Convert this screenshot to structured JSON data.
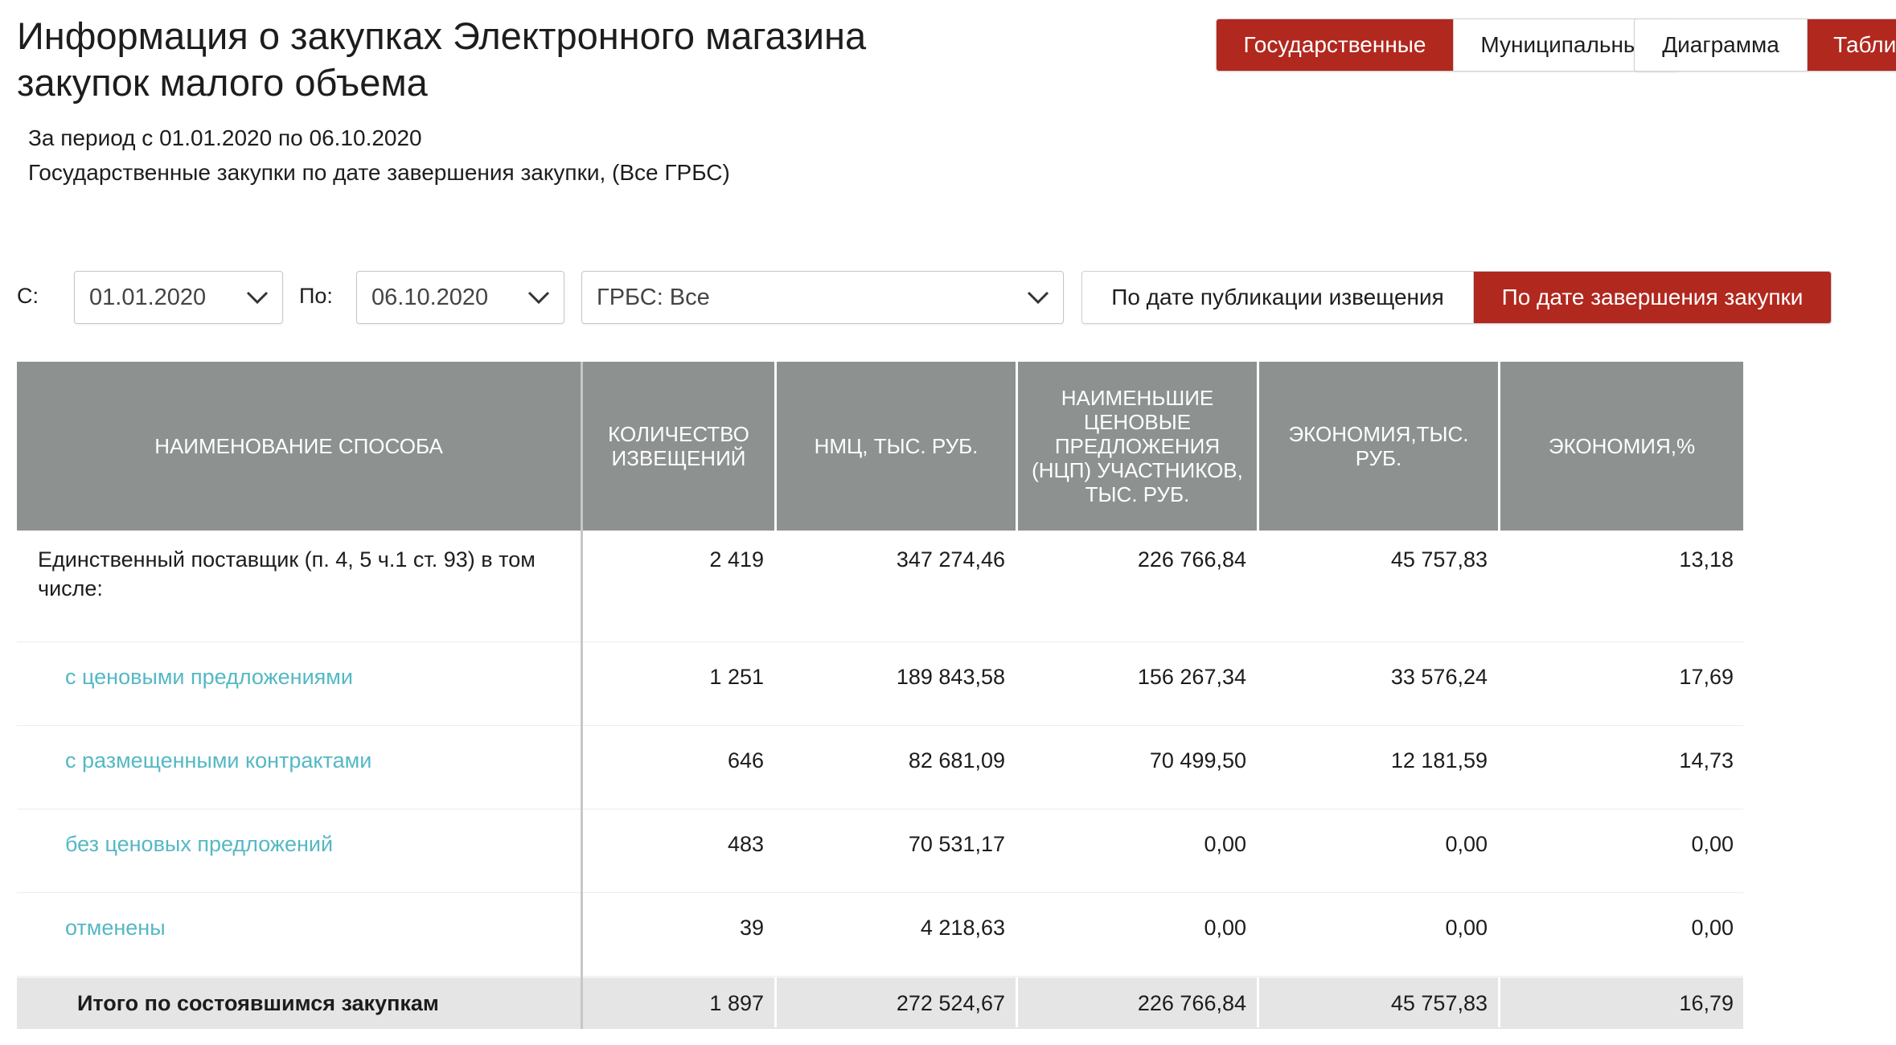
{
  "header": {
    "title_line1": "Информация о закупках Электронного магазина",
    "title_line2": "закупок малого объема",
    "period": "За период с 01.01.2020 по 06.10.2020",
    "description": "Государственные закупки по дате завершения закупки, (Все ГРБС)"
  },
  "toggles": {
    "level": [
      {
        "label": "Государственные",
        "active": true
      },
      {
        "label": "Муниципальные",
        "active": false
      }
    ],
    "view": [
      {
        "label": "Диаграмма",
        "active": false
      },
      {
        "label": "Таблица",
        "active": true
      }
    ],
    "date_mode": [
      {
        "label": "По дате публикации извещения",
        "active": false
      },
      {
        "label": "По дате завершения закупки",
        "active": true
      }
    ]
  },
  "filters": {
    "from_label": "С:",
    "from_value": "01.01.2020",
    "to_label": "По:",
    "to_value": "06.10.2020",
    "grbs_value": "ГРБС: Все"
  },
  "table": {
    "columns": [
      "НАИМЕНОВАНИЕ СПОСОБА",
      "КОЛИЧЕСТВО ИЗВЕЩЕНИЙ",
      "НМЦ, ТЫС. РУБ.",
      "НАИМЕНЬШИЕ ЦЕНОВЫЕ ПРЕДЛОЖЕНИЯ (НЦП) УЧАСТНИКОВ, ТЫС. РУБ.",
      "ЭКОНОМИЯ,ТЫС. РУБ.",
      "ЭКОНОМИЯ,%"
    ],
    "rows": [
      {
        "name": "Единственный поставщик (п. 4, 5 ч.1 ст. 93) в том числе:",
        "count": "2 419",
        "nmc": "347 274,46",
        "ncp": "226 766,84",
        "econ": "45 757,83",
        "pct": "13,18"
      },
      {
        "name": "с ценовыми предложениями",
        "count": "1 251",
        "nmc": "189 843,58",
        "ncp": "156 267,34",
        "econ": "33 576,24",
        "pct": "17,69"
      },
      {
        "name": "с размещенными контрактами",
        "count": "646",
        "nmc": "82 681,09",
        "ncp": "70 499,50",
        "econ": "12 181,59",
        "pct": "14,73"
      },
      {
        "name": "без ценовых предложений",
        "count": "483",
        "nmc": "70 531,17",
        "ncp": "0,00",
        "econ": "0,00",
        "pct": "0,00"
      },
      {
        "name": "отменены",
        "count": "39",
        "nmc": "4 218,63",
        "ncp": "0,00",
        "econ": "0,00",
        "pct": "0,00"
      }
    ],
    "total": {
      "name": "Итого по состоявшимся закупкам",
      "count": "1 897",
      "nmc": "272 524,67",
      "ncp": "226 766,84",
      "econ": "45 757,83",
      "pct": "16,79"
    }
  }
}
